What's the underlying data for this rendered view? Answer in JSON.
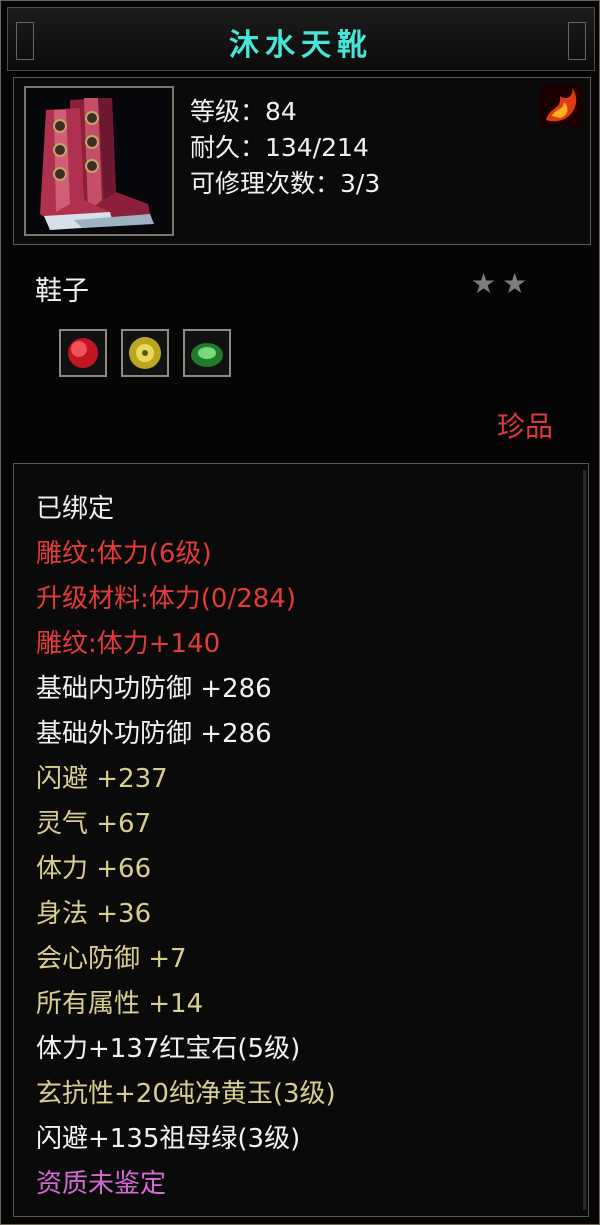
{
  "item": {
    "name": "沐水天靴",
    "level_label": "等级：84",
    "durability_label": "耐久：134/214",
    "repair_label": "可修理次数：3/3",
    "type": "鞋子",
    "star_count": 2,
    "rarity": "珍品"
  },
  "sockets": [
    {
      "name": "red-gem-icon",
      "color": "#d3182a"
    },
    {
      "name": "yellow-jade-icon",
      "color": "#c8b822"
    },
    {
      "name": "emerald-icon",
      "color": "#2fa537"
    }
  ],
  "attributes": [
    {
      "text": "已绑定",
      "color": "white"
    },
    {
      "text": "雕纹:体力(6级)",
      "color": "red"
    },
    {
      "text": "升级材料:体力(0/284)",
      "color": "red"
    },
    {
      "text": "雕纹:体力+140",
      "color": "red"
    },
    {
      "text": "基础内功防御  +286",
      "color": "white"
    },
    {
      "text": "基础外功防御  +286",
      "color": "white"
    },
    {
      "text": "闪避  +237",
      "color": "gold"
    },
    {
      "text": "灵气  +67",
      "color": "gold"
    },
    {
      "text": "体力  +66",
      "color": "gold"
    },
    {
      "text": "身法  +36",
      "color": "gold"
    },
    {
      "text": "会心防御  +7",
      "color": "gold"
    },
    {
      "text": "所有属性  +14",
      "color": "gold"
    },
    {
      "text": "体力+137红宝石(5级)",
      "color": "white"
    },
    {
      "text": "玄抗性+20纯净黄玉(3级)",
      "color": "gold"
    },
    {
      "text": "闪避+135祖母绿(3级)",
      "color": "white"
    },
    {
      "text": "资质未鉴定",
      "color": "purple"
    }
  ]
}
